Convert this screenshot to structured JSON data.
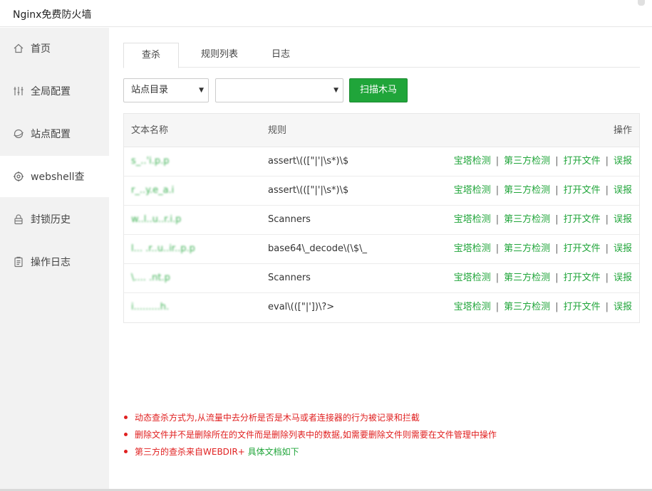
{
  "window": {
    "title": "Nginx免费防火墙"
  },
  "sidebar": {
    "items": [
      {
        "label": "首页",
        "icon": "home-icon"
      },
      {
        "label": "全局配置",
        "icon": "sliders-icon"
      },
      {
        "label": "站点配置",
        "icon": "globe-icon"
      },
      {
        "label": "webshell查",
        "icon": "target-icon",
        "active": true
      },
      {
        "label": "封锁历史",
        "icon": "lock-icon"
      },
      {
        "label": "操作日志",
        "icon": "clipboard-icon"
      }
    ]
  },
  "tabs": [
    {
      "label": "查杀",
      "active": true
    },
    {
      "label": "规则列表"
    },
    {
      "label": "日志"
    }
  ],
  "toolbar": {
    "site_select": {
      "value": "站点目录"
    },
    "path_select": {
      "value": ""
    },
    "scan_label": "扫描木马"
  },
  "table": {
    "headers": {
      "name": "文本名称",
      "rule": "规则",
      "ops": "操作"
    },
    "rows": [
      {
        "name": "s_..'i.p.p",
        "rule": "assert\\(([\"|'|\\s*)\\$"
      },
      {
        "name": "r_..y.e_a.i",
        "rule": "assert\\(([\"|'|\\s*)\\$"
      },
      {
        "name": "w..l..u..r.i.p",
        "rule": "Scanners"
      },
      {
        "name": "l... .r..u..ir..p.p",
        "rule": "base64\\_decode\\(\\$\\_"
      },
      {
        "name": "\\.... .nt.p",
        "rule": "Scanners"
      },
      {
        "name": "i.........h.",
        "rule": "eval\\(([\"|'])\\?>"
      }
    ],
    "actions": [
      "宝塔检测",
      "第三方检测",
      "打开文件",
      "误报"
    ]
  },
  "notes": [
    {
      "text": "动态查杀方式为,从流量中去分析是否是木马或者连接器的行为被记录和拦截"
    },
    {
      "text": "删除文件并不是删除所在的文件而是删除列表中的数据,如需要删除文件则需要在文件管理中操作"
    },
    {
      "text": "第三方的查杀来自WEBDIR+ ",
      "link": "具体文档如下"
    }
  ],
  "colors": {
    "accent": "#20a53a",
    "warning": "#e02020",
    "sidebar_bg": "#f2f2f2"
  }
}
